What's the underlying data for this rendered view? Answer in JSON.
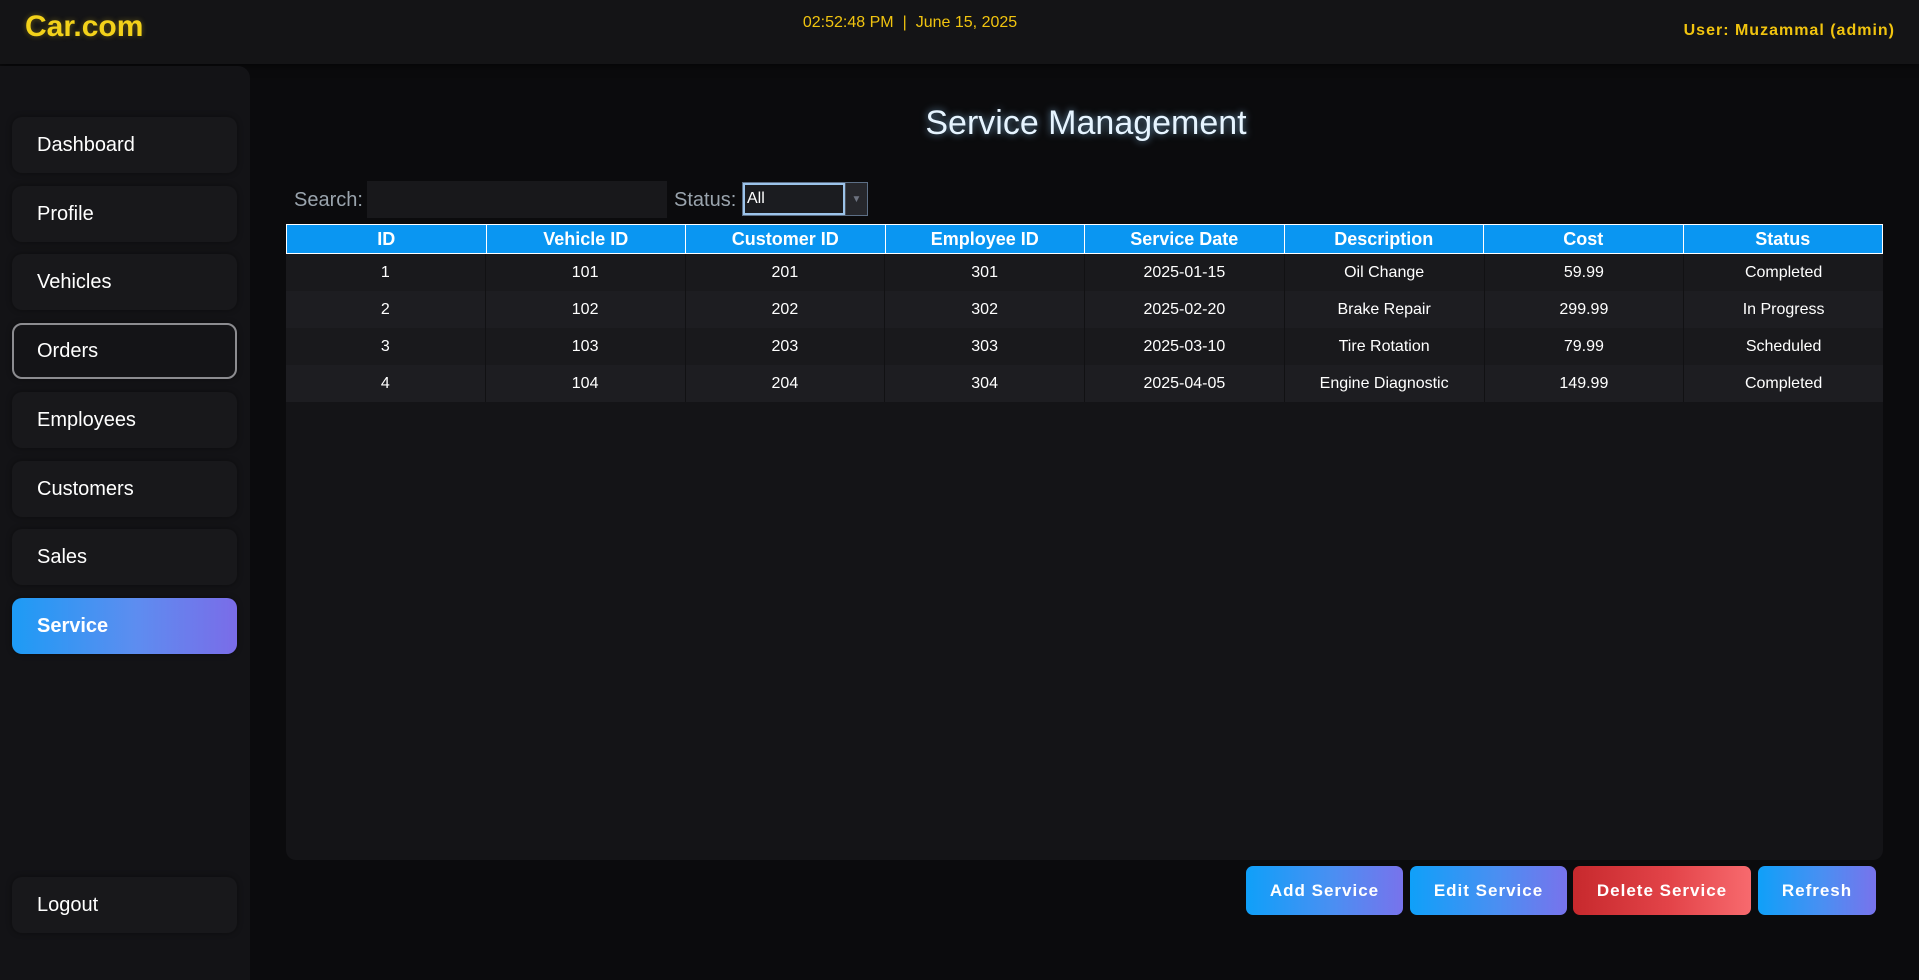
{
  "header": {
    "logo": "Car.com",
    "time": "02:52:48 PM",
    "separator": "|",
    "date": "June 15, 2025",
    "user": "User: Muzammal (admin)"
  },
  "sidebar": {
    "items": [
      {
        "label": "Dashboard",
        "state": "normal"
      },
      {
        "label": "Profile",
        "state": "normal"
      },
      {
        "label": "Vehicles",
        "state": "normal"
      },
      {
        "label": "Orders",
        "state": "outlined"
      },
      {
        "label": "Employees",
        "state": "normal"
      },
      {
        "label": "Customers",
        "state": "normal"
      },
      {
        "label": "Sales",
        "state": "normal"
      },
      {
        "label": "Service",
        "state": "active"
      }
    ],
    "logout": "Logout"
  },
  "main": {
    "title": "Service Management",
    "search_label": "Search:",
    "search_value": "",
    "status_label": "Status:",
    "status_value": "All"
  },
  "table": {
    "columns": [
      "ID",
      "Vehicle ID",
      "Customer ID",
      "Employee ID",
      "Service Date",
      "Description",
      "Cost",
      "Status"
    ],
    "rows": [
      [
        "1",
        "101",
        "201",
        "301",
        "2025-01-15",
        "Oil Change",
        "59.99",
        "Completed"
      ],
      [
        "2",
        "102",
        "202",
        "302",
        "2025-02-20",
        "Brake Repair",
        "299.99",
        "In Progress"
      ],
      [
        "3",
        "103",
        "203",
        "303",
        "2025-03-10",
        "Tire Rotation",
        "79.99",
        "Scheduled"
      ],
      [
        "4",
        "104",
        "204",
        "304",
        "2025-04-05",
        "Engine Diagnostic",
        "149.99",
        "Completed"
      ]
    ]
  },
  "actions": {
    "add": "Add Service",
    "edit": "Edit Service",
    "delete": "Delete Service",
    "refresh": "Refresh"
  },
  "colors": {
    "accent": "#0a96f2",
    "logo": "#f3d21a",
    "clock": "#f1c40f",
    "danger": "#e34449"
  }
}
